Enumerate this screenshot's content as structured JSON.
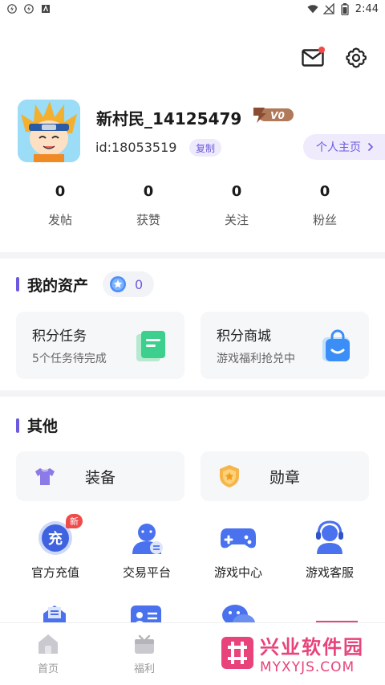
{
  "status": {
    "time": "2:44"
  },
  "profile": {
    "username": "新村民_14125479",
    "vip_label": "V0",
    "uid": "id:18053519",
    "copy_label": "复制",
    "home_label": "个人主页"
  },
  "stats": [
    {
      "value": "0",
      "label": "发帖"
    },
    {
      "value": "0",
      "label": "获赞"
    },
    {
      "value": "0",
      "label": "关注"
    },
    {
      "value": "0",
      "label": "粉丝"
    }
  ],
  "assets": {
    "title": "我的资产",
    "coins": "0",
    "cards": [
      {
        "title": "积分任务",
        "subtitle": "5个任务待完成"
      },
      {
        "title": "积分商城",
        "subtitle": "游戏福利抢兑中"
      }
    ]
  },
  "other": {
    "title": "其他",
    "wide": [
      {
        "label": "装备"
      },
      {
        "label": "勋章"
      }
    ],
    "grid": [
      {
        "label": "官方充值",
        "icon": "recharge-icon",
        "badge": "新"
      },
      {
        "label": "交易平台",
        "icon": "trade-icon"
      },
      {
        "label": "游戏中心",
        "icon": "gamepad-icon"
      },
      {
        "label": "游戏客服",
        "icon": "headset-icon"
      }
    ]
  },
  "tabs": [
    {
      "label": "首页"
    },
    {
      "label": "福利"
    }
  ],
  "watermark": {
    "cn": "兴业软件园",
    "en": "MYXYJS.COM"
  },
  "colors": {
    "accent": "#6b5ae0",
    "badge": "#f04b4b",
    "watermark": "#e8437a"
  }
}
